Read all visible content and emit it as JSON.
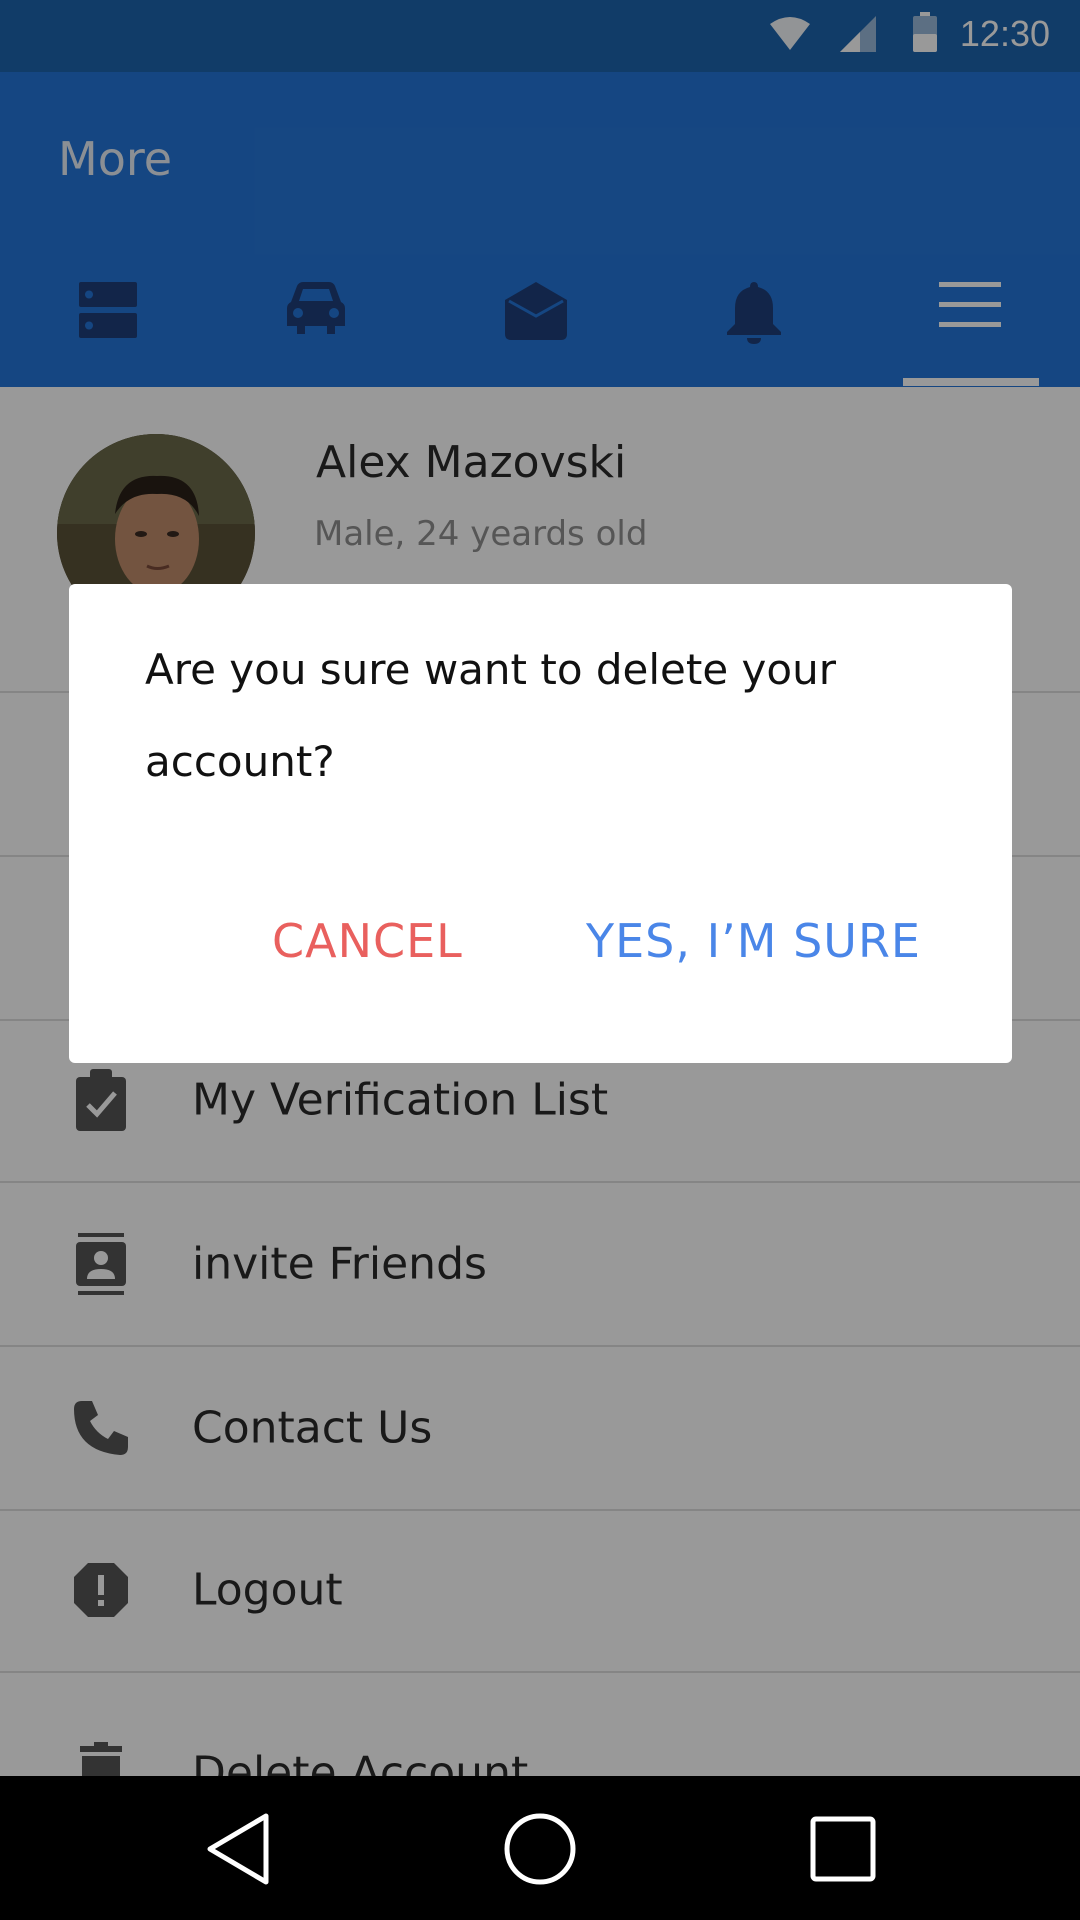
{
  "status_bar": {
    "time": "12:30",
    "icons": [
      "wifi-icon",
      "signal-icon",
      "battery-icon"
    ]
  },
  "app_bar": {
    "title": "More",
    "tabs": [
      {
        "name": "storage",
        "icon": "dashboard-icon"
      },
      {
        "name": "car",
        "icon": "car-icon"
      },
      {
        "name": "messages",
        "icon": "mail-open-icon"
      },
      {
        "name": "notifications",
        "icon": "bell-icon"
      },
      {
        "name": "more",
        "icon": "menu-icon",
        "selected": true
      }
    ]
  },
  "profile": {
    "name": "Alex Mazovski",
    "subtitle": "Male, 24 yeards old"
  },
  "menu": {
    "items": [
      {
        "label": "My Verification List",
        "icon": "checklist-icon"
      },
      {
        "label": "invite Friends",
        "icon": "contacts-icon"
      },
      {
        "label": "Contact Us",
        "icon": "phone-icon"
      },
      {
        "label": "Logout",
        "icon": "alert-octagon-icon"
      },
      {
        "label": "Delete Account",
        "icon": "trash-icon"
      }
    ]
  },
  "dialog": {
    "message": "Are you sure want to delete your account?",
    "cancel_label": "CANCEL",
    "confirm_label": "YES, I’M SURE"
  },
  "colors": {
    "status_bar": "#1d64ad",
    "app_bar": "#2476d9",
    "cancel": "#e9605e",
    "confirm": "#4a86e8"
  }
}
